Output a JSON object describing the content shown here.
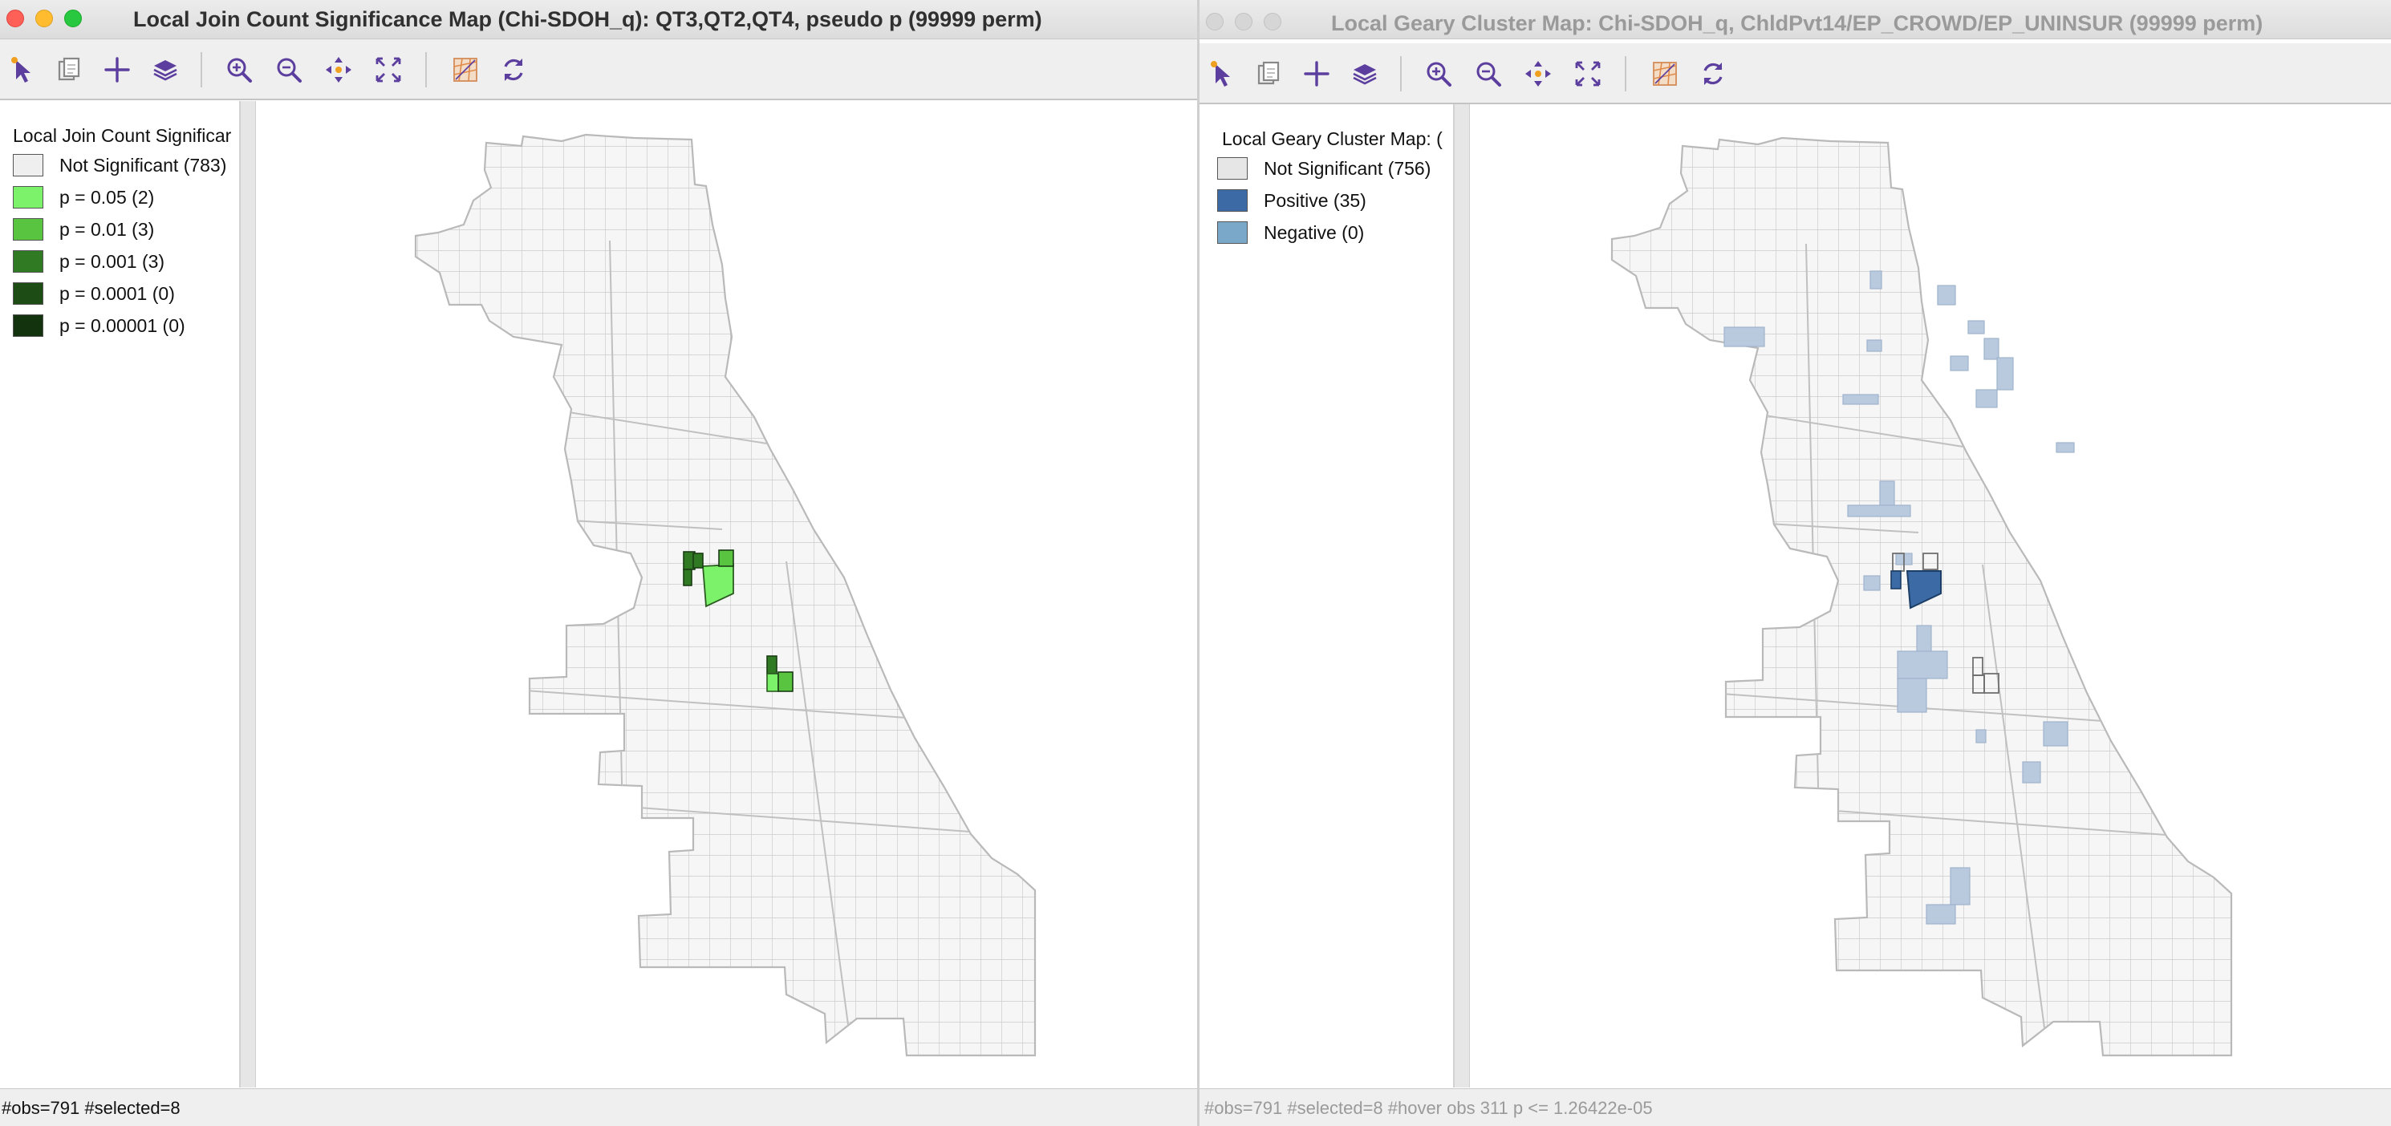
{
  "left_window": {
    "title": "Local Join Count Significance Map (Chi-SDOH_q): QT3,QT2,QT4, pseudo p (99999 perm)",
    "legend": {
      "title": "Local Join Count Significar",
      "items": [
        {
          "label": "Not Significant (783)",
          "color": "#efefef"
        },
        {
          "label": "p = 0.05 (2)",
          "color": "#7cf26b"
        },
        {
          "label": "p = 0.01 (3)",
          "color": "#58c43f"
        },
        {
          "label": "p = 0.001 (3)",
          "color": "#2f7a22"
        },
        {
          "label": "p = 0.0001 (0)",
          "color": "#1d4d15"
        },
        {
          "label": "p = 0.00001 (0)",
          "color": "#12330d"
        }
      ]
    },
    "status": "#obs=791 #selected=8"
  },
  "right_window": {
    "title": "Local Geary Cluster Map: Chi-SDOH_q, ChldPvt14/EP_CROWD/EP_UNINSUR (99999 perm)",
    "legend": {
      "title": "Local Geary Cluster Map: (",
      "items": [
        {
          "label": "Not Significant (756)",
          "color": "#e6e6e6"
        },
        {
          "label": "Positive (35)",
          "color": "#3b6aa5"
        },
        {
          "label": "Negative (0)",
          "color": "#79a8c8"
        }
      ]
    },
    "status": "#obs=791 #selected=8  #hover obs 311 p <= 1.26422e-05"
  },
  "toolbar_icons": [
    "select-icon",
    "copy-icon",
    "add-icon",
    "layers-icon",
    "zoom-in-icon",
    "zoom-out-icon",
    "pan-icon",
    "fit-extent-icon",
    "basemap-icon",
    "refresh-icon"
  ],
  "colors": {
    "accent": "#5b3e9e",
    "map_fill": "#f6f6f6",
    "map_stroke": "#c9c9c9",
    "positive_faded": "#b9c9de"
  }
}
